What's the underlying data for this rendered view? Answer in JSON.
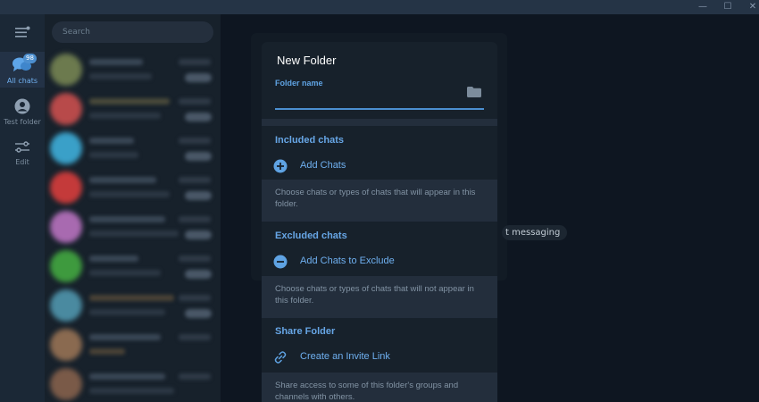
{
  "window": {
    "minimize_glyph": "—",
    "maximize_glyph": "☐",
    "close_glyph": "✕"
  },
  "rail": {
    "all_chats_label": "All chats",
    "badge_count": "98",
    "test_folder_label": "Test folder",
    "edit_label": "Edit"
  },
  "search": {
    "placeholder": "Search"
  },
  "background": {
    "messaging_pill": "t messaging"
  },
  "dialog": {
    "title": "New Folder",
    "folder_name_label": "Folder name",
    "folder_name_value": "",
    "included": {
      "title": "Included chats",
      "action": "Add Chats",
      "hint": "Choose chats or types of chats that will appear in this folder."
    },
    "excluded": {
      "title": "Excluded chats",
      "action": "Add Chats to Exclude",
      "hint": "Choose chats or types of chats that will not appear in this folder."
    },
    "share": {
      "title": "Share Folder",
      "action": "Create an Invite Link",
      "hint": "Share access to some of this folder's groups and channels with others."
    }
  },
  "colors": {
    "accent": "#5fa3e3",
    "dialog_bg": "#17212b",
    "separator": "#232e3c"
  }
}
